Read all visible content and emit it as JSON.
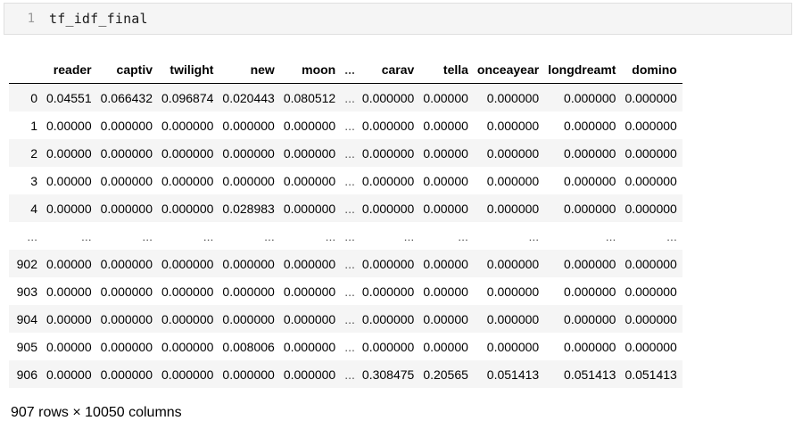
{
  "cell": {
    "line_number": "1",
    "code": "tf_idf_final"
  },
  "table": {
    "columns": [
      "",
      "reader",
      "captiv",
      "twilight",
      "new",
      "moon",
      "...",
      "carav",
      "tella",
      "onceayear",
      "longdreamt",
      "domino"
    ],
    "rows": [
      [
        "0",
        "0.04551",
        "0.066432",
        "0.096874",
        "0.020443",
        "0.080512",
        "...",
        "0.000000",
        "0.00000",
        "0.000000",
        "0.000000",
        "0.000000"
      ],
      [
        "1",
        "0.00000",
        "0.000000",
        "0.000000",
        "0.000000",
        "0.000000",
        "...",
        "0.000000",
        "0.00000",
        "0.000000",
        "0.000000",
        "0.000000"
      ],
      [
        "2",
        "0.00000",
        "0.000000",
        "0.000000",
        "0.000000",
        "0.000000",
        "...",
        "0.000000",
        "0.00000",
        "0.000000",
        "0.000000",
        "0.000000"
      ],
      [
        "3",
        "0.00000",
        "0.000000",
        "0.000000",
        "0.000000",
        "0.000000",
        "...",
        "0.000000",
        "0.00000",
        "0.000000",
        "0.000000",
        "0.000000"
      ],
      [
        "4",
        "0.00000",
        "0.000000",
        "0.000000",
        "0.028983",
        "0.000000",
        "...",
        "0.000000",
        "0.00000",
        "0.000000",
        "0.000000",
        "0.000000"
      ],
      [
        "...",
        "...",
        "...",
        "...",
        "...",
        "...",
        "...",
        "...",
        "...",
        "...",
        "...",
        "..."
      ],
      [
        "902",
        "0.00000",
        "0.000000",
        "0.000000",
        "0.000000",
        "0.000000",
        "...",
        "0.000000",
        "0.00000",
        "0.000000",
        "0.000000",
        "0.000000"
      ],
      [
        "903",
        "0.00000",
        "0.000000",
        "0.000000",
        "0.000000",
        "0.000000",
        "...",
        "0.000000",
        "0.00000",
        "0.000000",
        "0.000000",
        "0.000000"
      ],
      [
        "904",
        "0.00000",
        "0.000000",
        "0.000000",
        "0.000000",
        "0.000000",
        "...",
        "0.000000",
        "0.00000",
        "0.000000",
        "0.000000",
        "0.000000"
      ],
      [
        "905",
        "0.00000",
        "0.000000",
        "0.000000",
        "0.008006",
        "0.000000",
        "...",
        "0.000000",
        "0.00000",
        "0.000000",
        "0.000000",
        "0.000000"
      ],
      [
        "906",
        "0.00000",
        "0.000000",
        "0.000000",
        "0.000000",
        "0.000000",
        "...",
        "0.308475",
        "0.20565",
        "0.051413",
        "0.051413",
        "0.051413"
      ]
    ]
  },
  "summary": "907 rows × 10050 columns"
}
